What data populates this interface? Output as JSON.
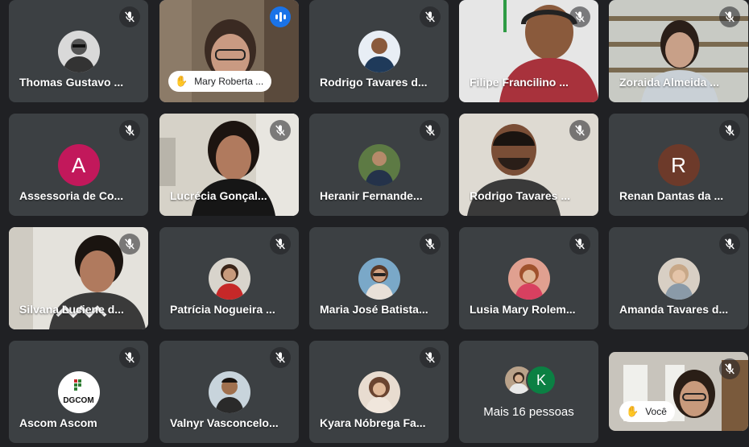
{
  "participants": [
    {
      "name": "Thomas Gustavo ...",
      "muted": true
    },
    {
      "name": "Mary Roberta ...",
      "hand_raised": true,
      "speaking": true
    },
    {
      "name": "Rodrigo Tavares d...",
      "muted": true
    },
    {
      "name": "Filipe Francilino ...",
      "muted": true
    },
    {
      "name": "Zoraida Almeida ...",
      "muted": true
    },
    {
      "name": "Assessoria de Co...",
      "initial": "A",
      "color": "#c2185b",
      "muted": true
    },
    {
      "name": "Lucrécia Gonçal...",
      "muted": true
    },
    {
      "name": "Heranir Fernande...",
      "muted": true
    },
    {
      "name": "Rodrigo Tavares ...",
      "muted": true
    },
    {
      "name": "Renan Dantas da ...",
      "initial": "R",
      "color": "#6d3a2a",
      "muted": true
    },
    {
      "name": "Silvana Luciene d...",
      "muted": true
    },
    {
      "name": "Patrícia Nogueira ...",
      "muted": true
    },
    {
      "name": "Maria José Batista...",
      "muted": true
    },
    {
      "name": "Lusia Mary Rolem...",
      "muted": true
    },
    {
      "name": "Amanda Tavares d...",
      "muted": true
    },
    {
      "name": "Ascom Ascom",
      "logo_text": "DGCOM",
      "muted": true
    },
    {
      "name": "Valnyr Vasconcelo...",
      "muted": true
    },
    {
      "name": "Kyara Nóbrega Fa...",
      "muted": true
    }
  ],
  "more": {
    "label": "Mais 16 pessoas",
    "initial": "K",
    "color": "#0b8043"
  },
  "self": {
    "label": "Você",
    "muted": true
  }
}
